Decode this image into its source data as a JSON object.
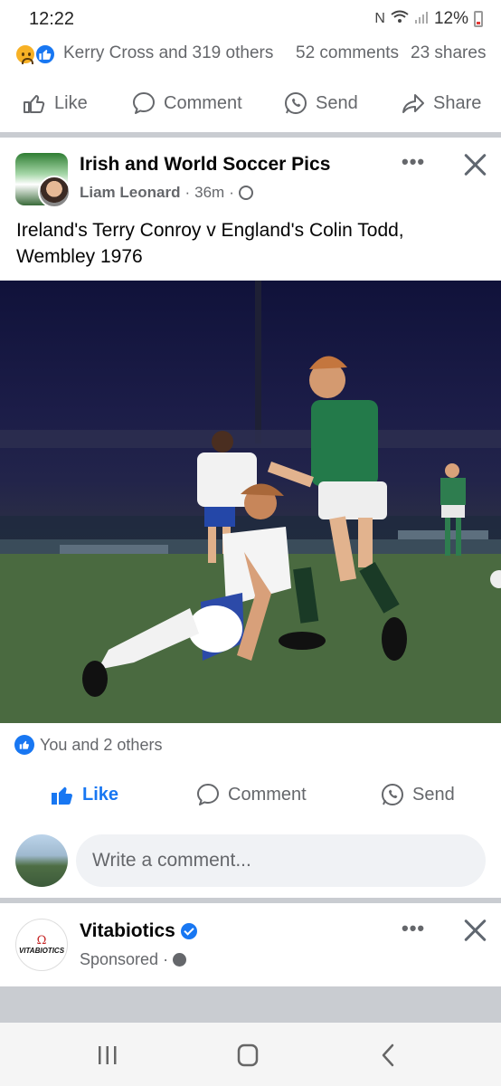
{
  "status": {
    "time": "12:22",
    "battery": "12%"
  },
  "prev_post": {
    "reactions_text": "Kerry Cross and 319 others",
    "comments": "52 comments",
    "shares": "23 shares",
    "actions": {
      "like": "Like",
      "comment": "Comment",
      "send": "Send",
      "share": "Share"
    }
  },
  "post": {
    "page_name": "Irish and World Soccer Pics",
    "author": "Liam Leonard",
    "time": "36m",
    "text": "Ireland's Terry Conroy v England's Colin Todd, Wembley 1976",
    "likes_text": "You and 2 others",
    "actions": {
      "like": "Like",
      "comment": "Comment",
      "send": "Send"
    },
    "comment_placeholder": "Write a comment..."
  },
  "sponsored_post": {
    "name": "Vitabiotics",
    "label": "Sponsored",
    "logo_text": "VITABIOTICS"
  },
  "colors": {
    "facebook_blue": "#1877f2",
    "secondary_text": "#65676b",
    "divider": "#c9ccd1"
  }
}
